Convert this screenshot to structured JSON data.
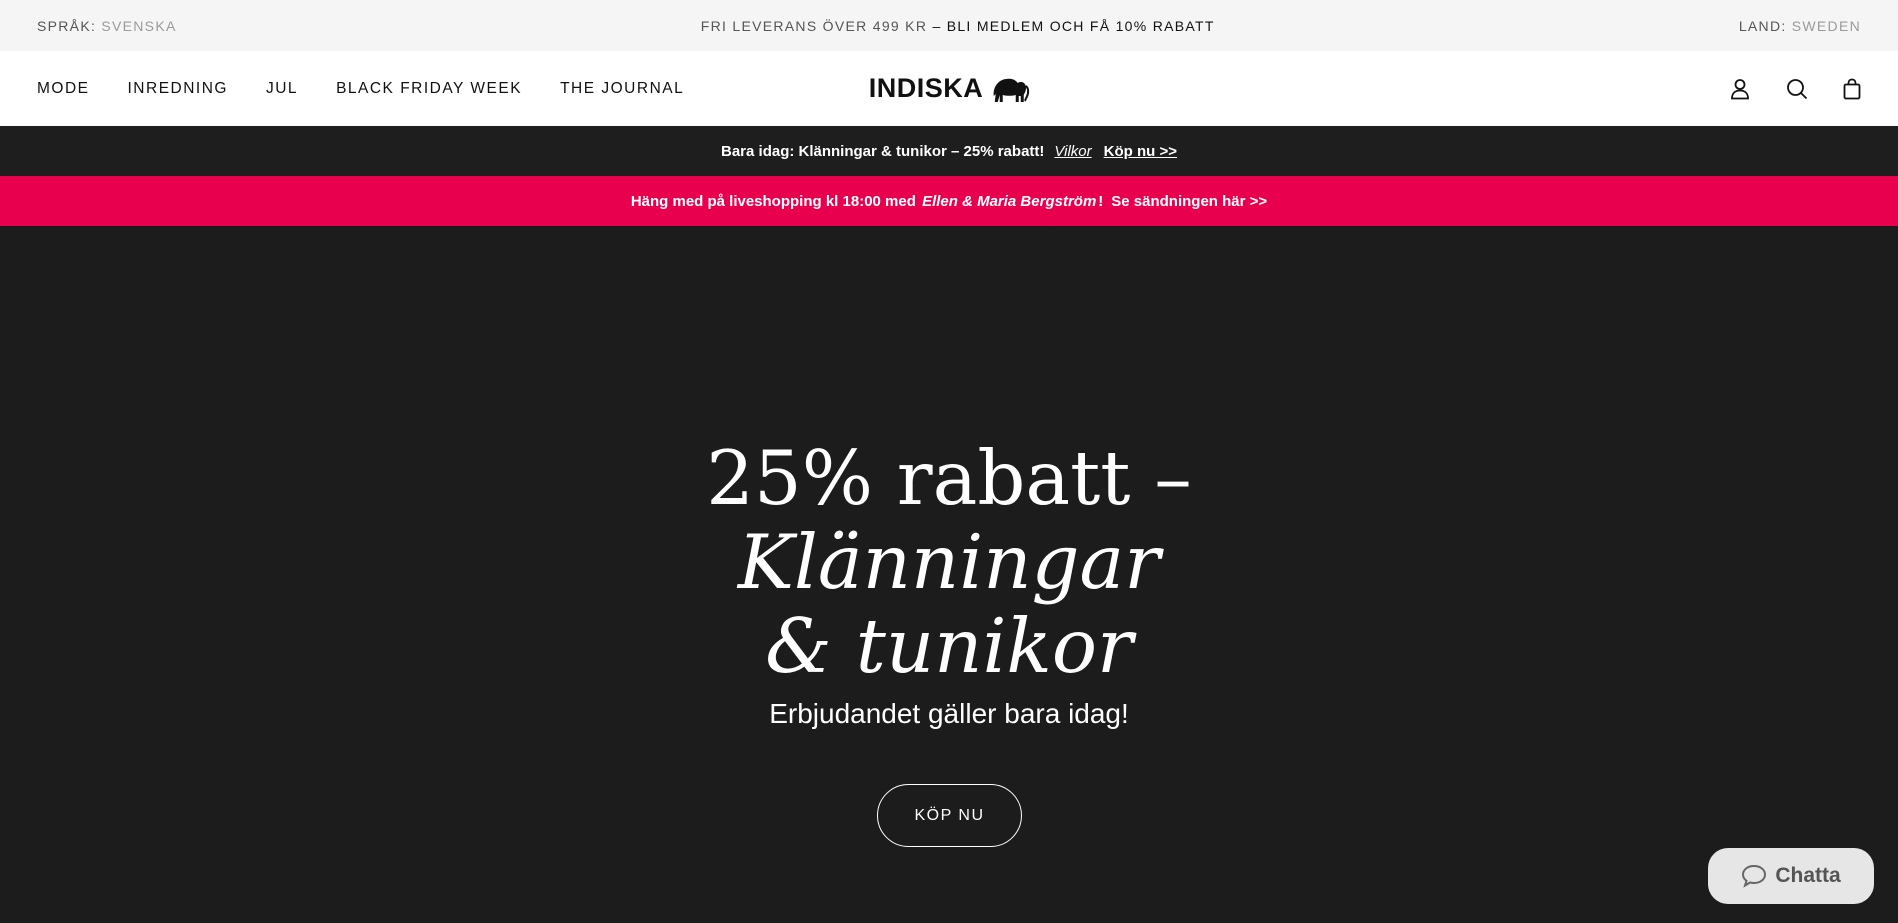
{
  "topbar": {
    "language_label": "SPRÅK:",
    "language_value": "SVENSKA",
    "shipping": "FRI LEVERANS ÖVER 499 KR",
    "member": "– BLI MEDLEM OCH FÅ 10% RABATT",
    "country_label": "LAND:",
    "country_value": "SWEDEN"
  },
  "nav": {
    "items": [
      {
        "label": "MODE"
      },
      {
        "label": "INREDNING"
      },
      {
        "label": "JUL"
      },
      {
        "label": "BLACK FRIDAY WEEK"
      },
      {
        "label": "THE JOURNAL"
      }
    ],
    "logo_text": "INDISKA",
    "icons": [
      "user-icon",
      "search-icon",
      "bag-icon"
    ]
  },
  "promo_dark": {
    "text": "Bara idag: Klänningar & tunikor – 25% rabatt!",
    "terms": "Vilkor",
    "cta": "Köp nu >>"
  },
  "promo_pink": {
    "text_before": "Häng med på liveshopping kl 18:00 med",
    "names": "Ellen & Maria Bergström",
    "text_after": "!",
    "cta": "Se sändningen här >>"
  },
  "hero": {
    "line1": "25% rabatt –",
    "line2": "Klänningar",
    "line3": "& tunikor",
    "subtitle": "Erbjudandet gäller bara idag!",
    "button": "KÖP NU"
  },
  "chat": {
    "label": "Chatta"
  },
  "colors": {
    "pink": "#e8004f",
    "dark": "#1c1c1c",
    "topbar_bg": "#f5f5f5"
  }
}
